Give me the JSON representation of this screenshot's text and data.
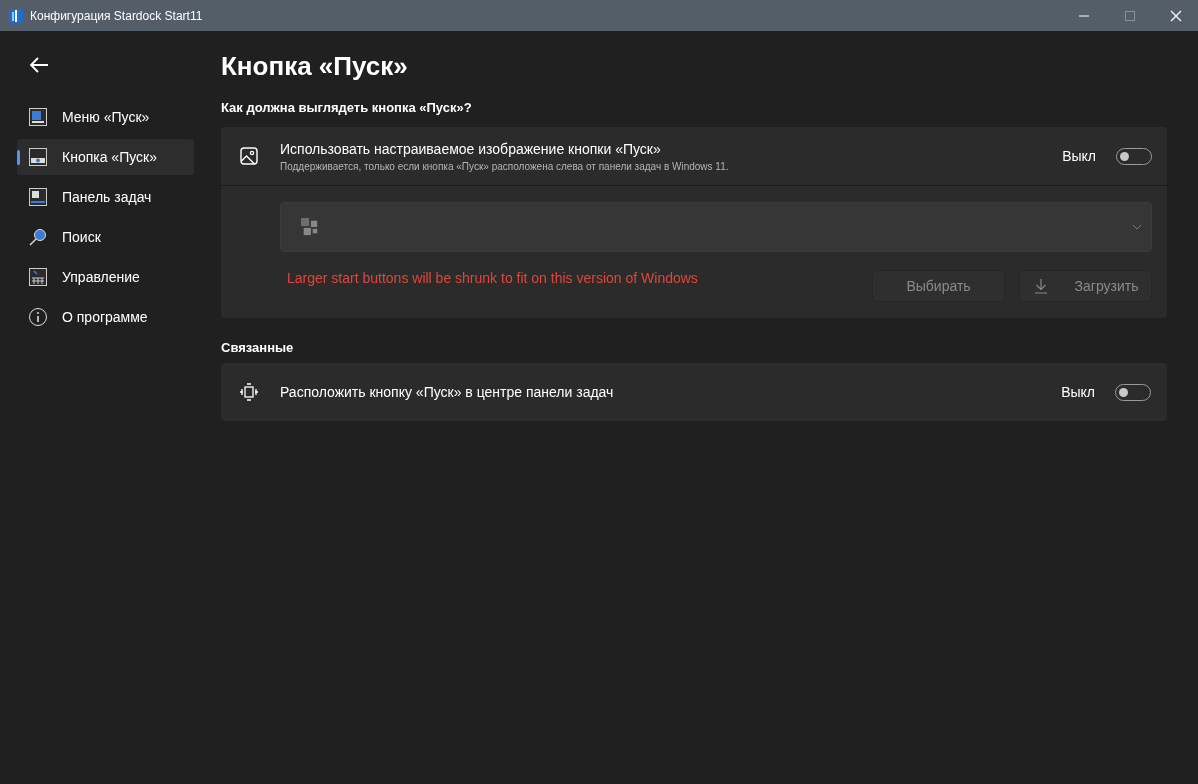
{
  "window": {
    "title": "Конфигурация Stardock Start11"
  },
  "sidebar": {
    "items": [
      {
        "label": "Меню «Пуск»",
        "selected": false,
        "kind": "start-menu"
      },
      {
        "label": "Кнопка «Пуск»",
        "selected": true,
        "kind": "start-button"
      },
      {
        "label": "Панель задач",
        "selected": false,
        "kind": "taskbar"
      },
      {
        "label": "Поиск",
        "selected": false,
        "kind": "search"
      },
      {
        "label": "Управление",
        "selected": false,
        "kind": "control"
      },
      {
        "label": "О программе",
        "selected": false,
        "kind": "about"
      }
    ]
  },
  "page_title": "Кнопка «Пуск»",
  "section_heading": "Как должна выглядеть кнопка «Пуск»?",
  "custom_image": {
    "title": "Использовать настраиваемое изображение кнопки «Пуск»",
    "description": "Поддерживается, только если кнопка «Пуск» расположена слева от панели задач в Windows 11.",
    "state_label": "Выкл",
    "on": false,
    "warning": "Larger start buttons will be shrunk to fit on this version of Windows",
    "buttons": [
      {
        "label": "Выбирать",
        "disabled": true,
        "kind": "plain"
      },
      {
        "label": "Загрузить",
        "disabled": true,
        "kind": "download"
      }
    ]
  },
  "related_heading": "Связанные",
  "center_setting": {
    "title": "Расположить кнопку «Пуск» в центре панели задач",
    "state_label": "Выкл",
    "on": false
  }
}
